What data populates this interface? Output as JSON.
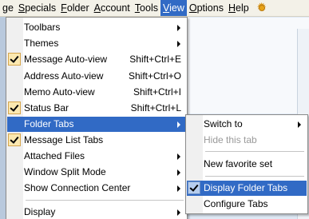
{
  "menubar": {
    "items": [
      {
        "label": "ge",
        "accel": ""
      },
      {
        "label": "Specials",
        "accel": "S"
      },
      {
        "label": "Folder",
        "accel": "F"
      },
      {
        "label": "Account",
        "accel": "A"
      },
      {
        "label": "Tools",
        "accel": "T"
      },
      {
        "label": "View",
        "accel": "V"
      },
      {
        "label": "Options",
        "accel": "O"
      },
      {
        "label": "Help",
        "accel": "H"
      }
    ],
    "right_icon": "sun-icon"
  },
  "view_menu": {
    "items": [
      {
        "label": "Toolbars",
        "submenu": true
      },
      {
        "label": "Themes",
        "submenu": true
      },
      {
        "label": "Message Auto-view",
        "shortcut": "Shift+Ctrl+E",
        "checked": true
      },
      {
        "label": "Address Auto-view",
        "shortcut": "Shift+Ctrl+O"
      },
      {
        "label": "Memo Auto-view",
        "shortcut": "Shift+Ctrl+I"
      },
      {
        "label": "Status Bar",
        "shortcut": "Shift+Ctrl+L",
        "checked": true
      },
      {
        "label": "Folder Tabs",
        "submenu": true,
        "highlighted": true
      },
      {
        "label": "Message List Tabs",
        "checked": true
      },
      {
        "label": "Attached Files",
        "submenu": true
      },
      {
        "label": "Window Split Mode",
        "submenu": true
      },
      {
        "label": "Show Connection Center",
        "submenu": true
      },
      {
        "label": "Display",
        "submenu": true
      }
    ]
  },
  "folder_tabs_submenu": {
    "items": [
      {
        "label": "Switch to",
        "submenu": true
      },
      {
        "label": "Hide this tab",
        "disabled": true
      },
      {
        "label": "New favorite set"
      },
      {
        "label": "Display Folder Tabs",
        "checked": true,
        "highlighted": true
      },
      {
        "label": "Configure Tabs"
      }
    ]
  },
  "colors": {
    "highlight": "#316ac5",
    "menubar_bg": "#f3f1e8"
  }
}
